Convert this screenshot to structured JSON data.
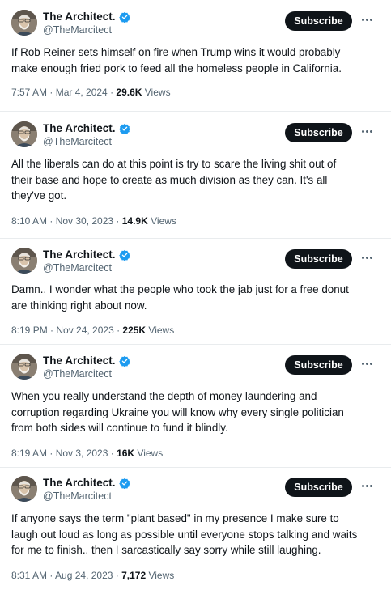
{
  "tweets": [
    {
      "name": "The Architect.",
      "handle": "@TheMarcitect",
      "subscribe_label": "Subscribe",
      "text": "If Rob Reiner sets himself on fire when Trump wins it would probably\nmake enough fried pork to feed all the homeless people in California.",
      "timestamp": "7:57 AM · Mar 4, 2024 · ",
      "views_count": "29.6K",
      "views_label": " Views"
    },
    {
      "name": "The Architect.",
      "handle": "@TheMarcitect",
      "subscribe_label": "Subscribe",
      "text": "All the liberals can do at this point is try to scare the living shit out of\ntheir base and hope to create as much division as they can. It's all\nthey've got.",
      "timestamp": "8:10 AM · Nov 30, 2023 · ",
      "views_count": "14.9K",
      "views_label": " Views"
    },
    {
      "name": "The Architect.",
      "handle": "@TheMarcitect",
      "subscribe_label": "Subscribe",
      "text": "Damn.. I wonder what the people who took the jab just for a free donut\nare thinking right about now.",
      "timestamp": "8:19 PM · Nov 24, 2023 · ",
      "views_count": "225K",
      "views_label": " Views"
    },
    {
      "name": "The Architect.",
      "handle": "@TheMarcitect",
      "subscribe_label": "Subscribe",
      "text": "When you really understand the depth of money laundering and\ncorruption regarding Ukraine you will know why every single politician\nfrom both sides will continue to fund it blindly.",
      "timestamp": "8:19 AM · Nov 3, 2023 · ",
      "views_count": "16K",
      "views_label": " Views"
    },
    {
      "name": "The Architect.",
      "handle": "@TheMarcitect",
      "subscribe_label": "Subscribe",
      "text": "If anyone says the term \"plant based\" in my presence I make sure to\nlaugh out loud as long as possible until everyone stops talking and waits\nfor me to finish.. then I sarcastically say sorry while still laughing.",
      "timestamp": "8:31 AM · Aug 24, 2023 · ",
      "views_count": "7,172",
      "views_label": " Views"
    }
  ],
  "colors": {
    "verified_badge": "#1d9bf0",
    "subscribe_bg": "#0f1419",
    "secondary_text": "#536471"
  },
  "icons": {
    "verified": "verified-badge-icon",
    "more": "more-horizontal-icon",
    "avatar": "profile-avatar"
  }
}
